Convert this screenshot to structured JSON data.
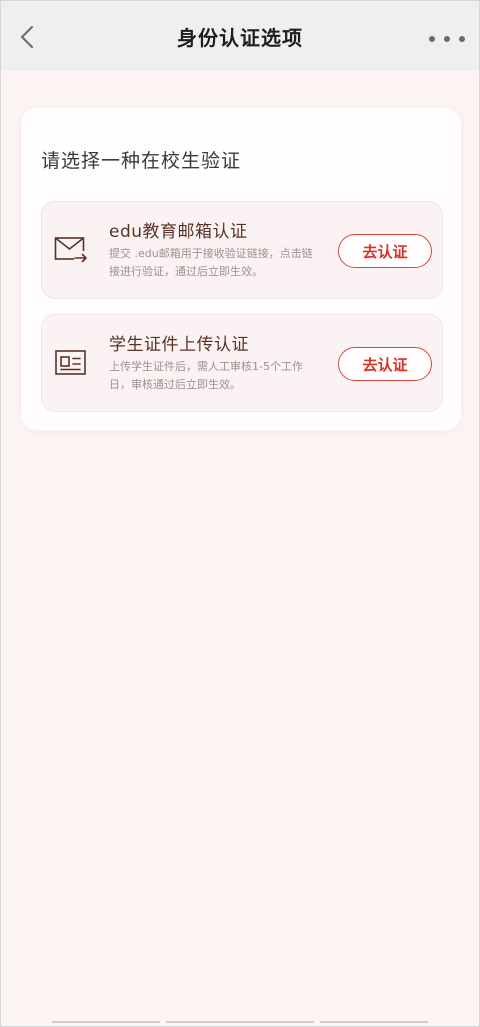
{
  "nav": {
    "title": "身份认证选项",
    "back_icon": "chevron-left-icon",
    "more_icon": "more-dots-icon"
  },
  "panel": {
    "title": "请选择一种在校生验证"
  },
  "options": [
    {
      "icon": "mail-send-icon",
      "title": "edu教育邮箱认证",
      "desc": "提交 .edu邮箱用于接收验证链接，点击链接进行验证，通过后立即生效。",
      "button": "去认证"
    },
    {
      "icon": "id-card-icon",
      "title": "学生证件上传认证",
      "desc": "上传学生证件后，需人工审核1-5个工作日，审核通过后立即生效。",
      "button": "去认证"
    }
  ],
  "colors": {
    "accent": "#d8322a",
    "title_brown": "#5a3326",
    "background": "#fbf4f3"
  }
}
